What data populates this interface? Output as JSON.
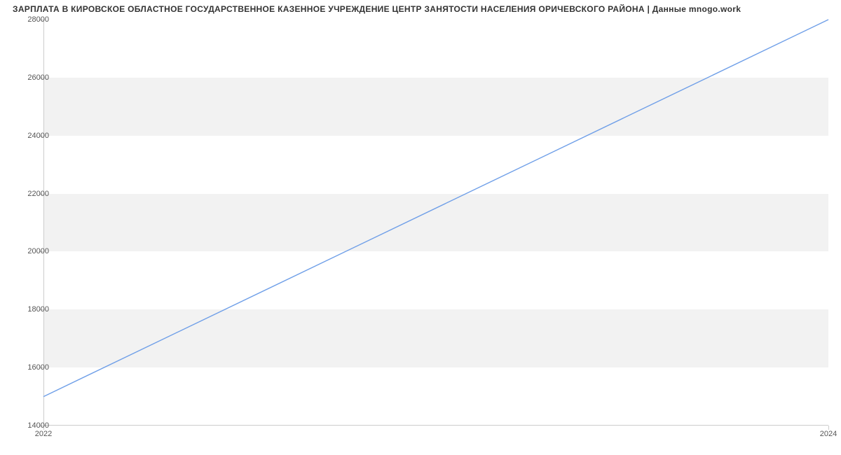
{
  "chart_data": {
    "type": "line",
    "title": "ЗАРПЛАТА В КИРОВСКОЕ ОБЛАСТНОЕ ГОСУДАРСТВЕННОЕ КАЗЕННОЕ УЧРЕЖДЕНИЕ ЦЕНТР ЗАНЯТОСТИ НАСЕЛЕНИЯ ОРИЧЕВСКОГО РАЙОНА | Данные mnogo.work",
    "x": [
      2022,
      2024
    ],
    "values": [
      15000,
      28000
    ],
    "xlim": [
      2022,
      2024
    ],
    "ylim": [
      14000,
      28000
    ],
    "y_ticks": [
      14000,
      16000,
      18000,
      20000,
      22000,
      24000,
      26000,
      28000
    ],
    "x_ticks": [
      2022,
      2024
    ],
    "line_color": "#6f9fe8",
    "xlabel": "",
    "ylabel": ""
  }
}
